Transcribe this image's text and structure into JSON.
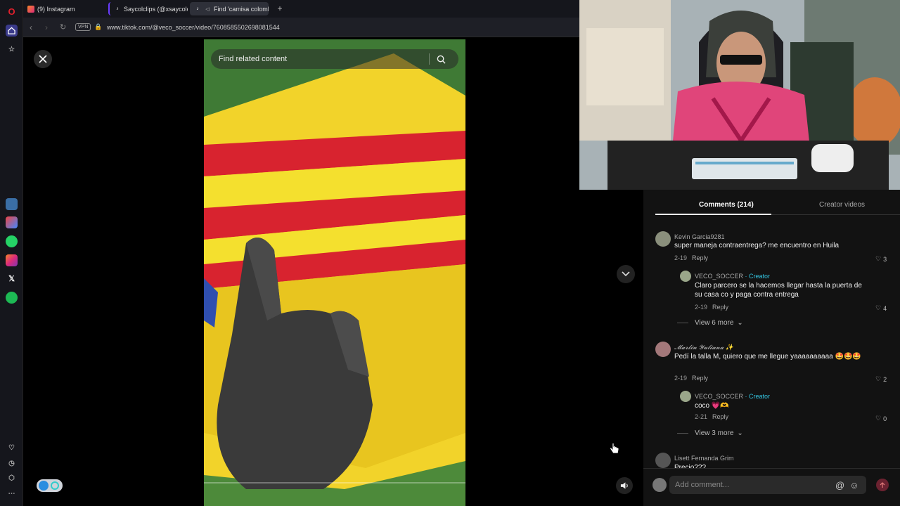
{
  "browser": {
    "tabs": [
      {
        "label": "(9) Instagram",
        "active": false
      },
      {
        "label": "Saycolclips (@xsaycolclips)",
        "active": false
      },
      {
        "label": "Find 'camisa colombia'",
        "active": true
      }
    ],
    "vpn_label": "VPN",
    "url": "www.tiktok.com/@veco_soccer/video/7608585502698081544"
  },
  "video": {
    "search_placeholder": "Find related content"
  },
  "panel": {
    "tab_comments": "Comments (214)",
    "tab_creator": "Creator videos",
    "comments": [
      {
        "author": "Kevin Garcia9281",
        "text": "super maneja contraentrega? me encuentro en Huila",
        "date": "2-19",
        "reply_label": "Reply",
        "likes": "3",
        "replies": [
          {
            "author": "VECO_SOCCER",
            "badge": " · Creator",
            "text": "Claro parcero se la hacemos llegar hasta la puerta de su casa co y paga contra entrega",
            "date": "2-19",
            "reply_label": "Reply",
            "likes": "4"
          }
        ],
        "view_more": "View 6 more"
      },
      {
        "author": "𝓜𝓪𝓻𝓵𝓲𝓷 𝓨𝓾𝓵𝓲𝓪𝓷𝓪 ✨",
        "text": "Pedí la talla M, quiero que me llegue yaaaaaaaaaa 🤩🤩🤩",
        "date": "2-19",
        "reply_label": "Reply",
        "likes": "2",
        "replies": [
          {
            "author": "VECO_SOCCER",
            "badge": " · Creator",
            "text": "coco 💗🫶",
            "date": "2-21",
            "reply_label": "Reply",
            "likes": "0"
          }
        ],
        "view_more": "View 3 more"
      },
      {
        "author": "Lisett Fernanda Grim",
        "text": "Precio???",
        "date": "",
        "reply_label": "",
        "likes": ""
      }
    ],
    "add_comment_placeholder": "Add comment..."
  },
  "colors": {
    "accent_creator": "#33c4e0",
    "post_button": "#6b2230"
  }
}
